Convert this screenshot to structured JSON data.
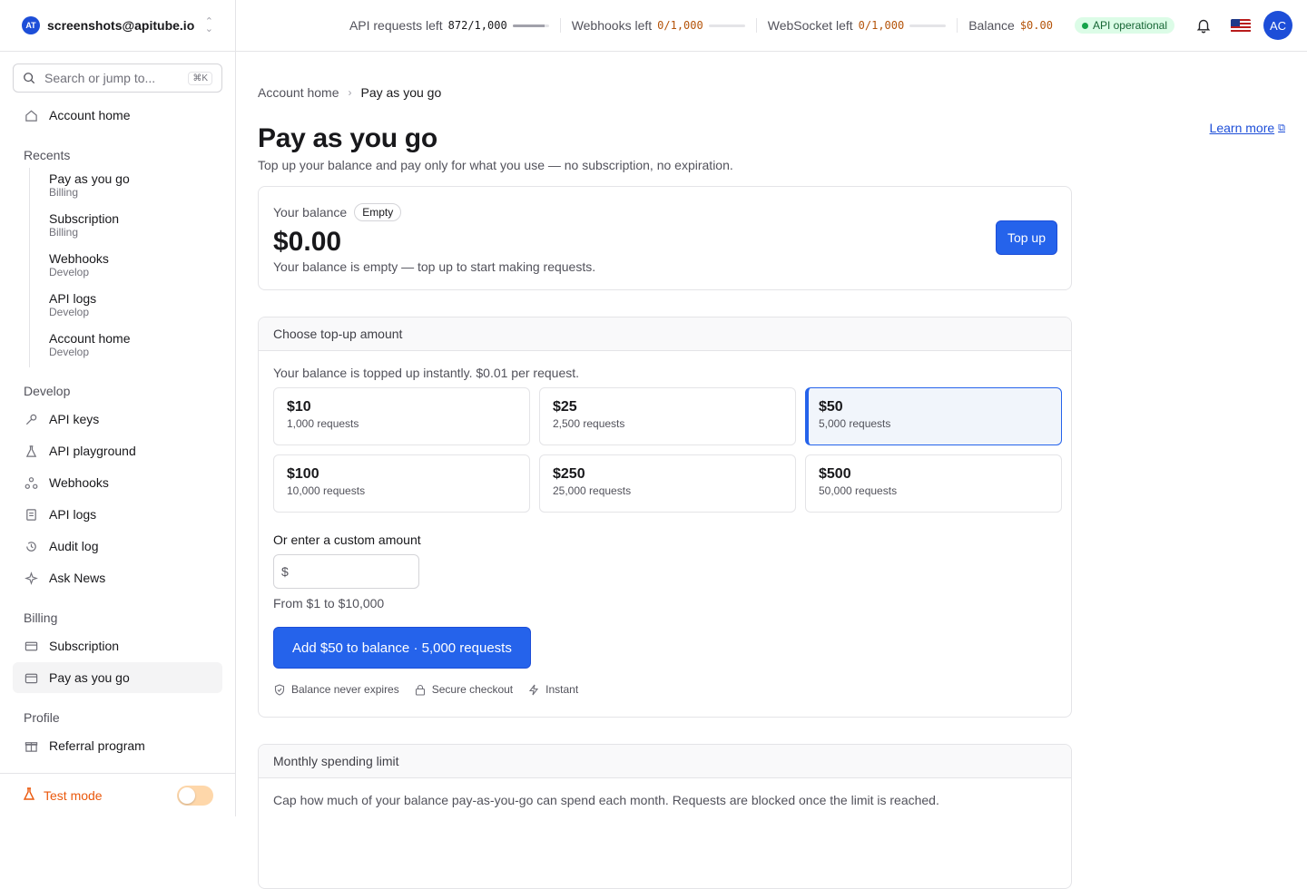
{
  "account": {
    "logo": "AT",
    "email": "screenshots@apitube.io"
  },
  "search": {
    "placeholder": "Search or jump to...",
    "shortcut": "⌘K"
  },
  "nav": {
    "account_home": "Account home",
    "recents_label": "Recents",
    "recents": [
      {
        "title": "Pay as you go",
        "sub": "Billing"
      },
      {
        "title": "Subscription",
        "sub": "Billing"
      },
      {
        "title": "Webhooks",
        "sub": "Develop"
      },
      {
        "title": "API logs",
        "sub": "Develop"
      },
      {
        "title": "Account home",
        "sub": "Develop"
      }
    ],
    "develop_label": "Develop",
    "develop": [
      "API keys",
      "API playground",
      "Webhooks",
      "API logs",
      "Audit log",
      "Ask News"
    ],
    "billing_label": "Billing",
    "billing": [
      "Subscription",
      "Pay as you go"
    ],
    "profile_label": "Profile",
    "profile": [
      "Referral program"
    ],
    "test_mode": "Test mode"
  },
  "topbar": {
    "api_requests": {
      "label": "API requests left",
      "value": "872/1,000",
      "fraction": 0.872
    },
    "webhooks": {
      "label": "Webhooks left",
      "value": "0/1,000",
      "fraction": 0
    },
    "websocket": {
      "label": "WebSocket left",
      "value": "0/1,000",
      "fraction": 0
    },
    "balance": {
      "label": "Balance",
      "value": "$0.00"
    },
    "status": "API operational",
    "avatar": "AC"
  },
  "breadcrumb": {
    "home": "Account home",
    "current": "Pay as you go"
  },
  "page": {
    "title": "Pay as you go",
    "subtitle": "Top up your balance and pay only for what you use — no subscription, no expiration.",
    "learn_more": "Learn more"
  },
  "balance_card": {
    "label": "Your balance",
    "badge": "Empty",
    "amount": "$0.00",
    "note": "Your balance is empty — top up to start making requests.",
    "topup": "Top up"
  },
  "topup": {
    "heading": "Choose top-up amount",
    "hint": "Your balance is topped up instantly. $0.01 per request.",
    "tiers": [
      {
        "price": "$10",
        "requests": "1,000 requests"
      },
      {
        "price": "$25",
        "requests": "2,500 requests"
      },
      {
        "price": "$50",
        "requests": "5,000 requests"
      },
      {
        "price": "$100",
        "requests": "10,000 requests"
      },
      {
        "price": "$250",
        "requests": "25,000 requests"
      },
      {
        "price": "$500",
        "requests": "50,000 requests"
      }
    ],
    "custom_label": "Or enter a custom amount",
    "custom_prefix": "$",
    "custom_value": "",
    "range_note": "From $1 to $10,000",
    "add_button": "Add $50 to balance · 5,000 requests",
    "features": [
      "Balance never expires",
      "Secure checkout",
      "Instant"
    ]
  },
  "limit": {
    "heading": "Monthly spending limit",
    "text": "Cap how much of your balance pay-as-you-go can spend each month. Requests are blocked once the limit is reached."
  },
  "colors": {
    "accent": "#2563eb",
    "warn": "#b45309",
    "status": "#16a34a",
    "test_mode": "#ea580c"
  }
}
